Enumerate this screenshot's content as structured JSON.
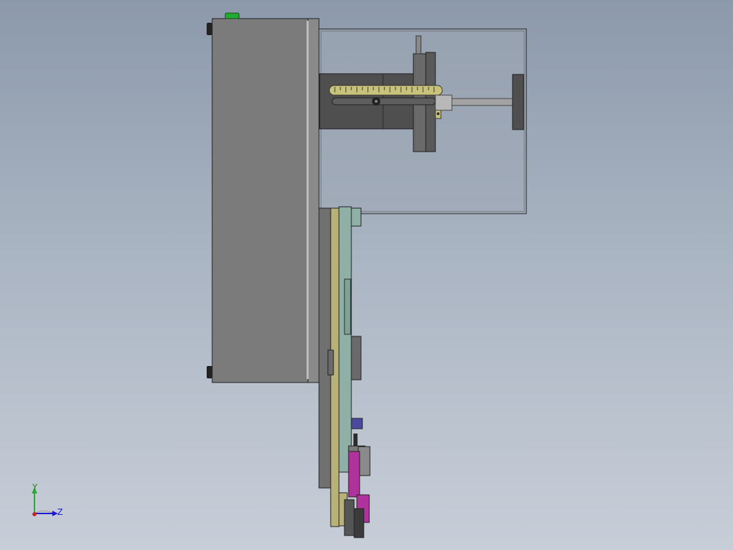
{
  "window": {
    "title": ""
  },
  "colors": {
    "background_top": "#8c99ab",
    "background_bottom": "#c8ced8",
    "main_housing": "#7b7b7b",
    "side_plate": "#6e6e6e",
    "guard_glass": "#9ea7b4",
    "ruler": "#c9c27a",
    "vertical_plate_green": "#8fb0a6",
    "vertical_plate_yellow": "#b8b27a",
    "purple_part": "#b0329c",
    "blue_part": "#4a4aa0",
    "green_button": "#22aa33"
  },
  "icons": {
    "triad": "coordinate-triad-icon",
    "button": "green-indicator-icon"
  },
  "triad": {
    "axis_y": "Y",
    "axis_z": "Z"
  }
}
